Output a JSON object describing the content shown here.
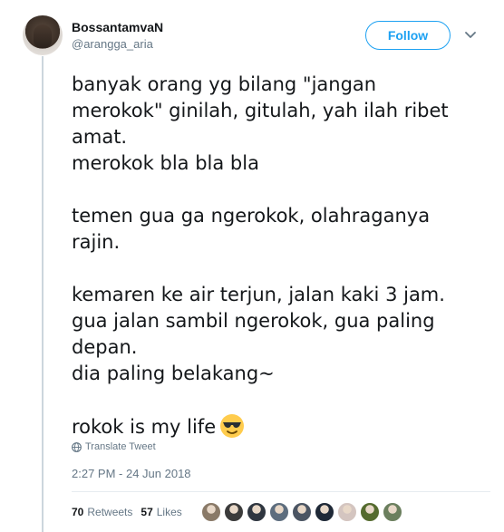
{
  "user": {
    "display_name": "BossantamvaN",
    "handle": "@arangga_aria"
  },
  "follow_button": {
    "label": "Follow"
  },
  "tweet": {
    "text": "banyak orang yg bilang \"jangan\nmerokok\" ginilah, gitulah, yah ilah ribet\namat.\nmerokok bla bla bla\n\ntemen gua ga ngerokok, olahraganya\nrajin.\n\nkemaren ke air terjun, jalan kaki 3 jam.\ngua jalan sambil ngerokok, gua paling\ndepan.\ndia paling belakang~\n\nrokok is my life",
    "emoji": "smiling-face-with-sunglasses"
  },
  "translate": {
    "label": "Translate Tweet"
  },
  "timestamp": "2:27 PM - 24 Jun 2018",
  "stats": {
    "retweets_count": "70",
    "retweets_label": "Retweets",
    "likes_count": "57",
    "likes_label": "Likes"
  },
  "colors": {
    "accent": "#1da1f2",
    "secondary_text": "#657786",
    "primary_text": "#14171a"
  },
  "likers": [
    {
      "color": "#8a7a68"
    },
    {
      "color": "#3b3b3b"
    },
    {
      "color": "#2f3640"
    },
    {
      "color": "#5d6d7e"
    },
    {
      "color": "#4b5563"
    },
    {
      "color": "#1f2937"
    },
    {
      "color": "#d4c5c0"
    },
    {
      "color": "#556b2f"
    },
    {
      "color": "#6b7f5e"
    }
  ]
}
